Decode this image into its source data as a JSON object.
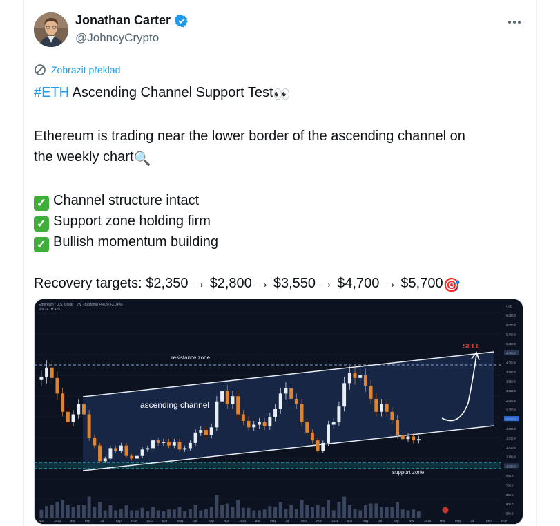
{
  "author": {
    "name": "Jonathan Carter",
    "handle": "@JohncyCrypto",
    "verified": true,
    "avatar_icon": "avatar-photo"
  },
  "more_icon": "more-dots-icon",
  "translate": {
    "label": "Zobrazit překlad",
    "icon": "translate-icon"
  },
  "tweet": {
    "hashtag": "#ETH",
    "title_rest": " Ascending Channel Support Test",
    "title_emoji": "👀",
    "line2": "Ethereum is trading near the lower border of the ascending channel on",
    "line3": "the weekly chart",
    "line3_emoji": "🔍",
    "checks": [
      "Channel structure intact",
      "Support zone holding firm",
      "Bullish momentum building"
    ],
    "targets": "Recovery targets: $2,350 → $2,800 → $3,550 → $4,700 → $5,700",
    "targets_emoji": "🎯"
  },
  "colors": {
    "link": "#1d9bf0",
    "text": "#0f1419",
    "muted": "#536471",
    "check": "#3fae3a",
    "chart_bg": "#0d1220",
    "candle_up": "#e8eef5",
    "candle_down": "#e0832f",
    "sell": "#e53935"
  },
  "chart": {
    "header": "Ethereum / U.S. Dollar · 1W · Bitstamp  +60.3 (+3.04%)",
    "subheader": "Vol · ETH  47K",
    "labels": {
      "resistance": "resistance zone",
      "channel": "ascending channel",
      "support": "support zone",
      "sell": "SELL"
    },
    "price_ticks": [
      "USD",
      "6,400.0",
      "6,000.0",
      "5,700.0",
      "5,250.0",
      "4,700.0",
      "4,250.0",
      "3,850.0",
      "3,550.0",
      "3,250.0",
      "2,800.0",
      "2,350.0",
      "2,042.4",
      "1,900.0",
      "1,550.0",
      "1,410.0",
      "1,190.0",
      "1,050.0",
      "905.0",
      "780.0",
      "685.0",
      "605.0",
      "535.0"
    ],
    "time_ticks": [
      "Nov",
      "2022",
      "Mar",
      "May",
      "Jul",
      "Sep",
      "Nov",
      "2023",
      "Mar",
      "May",
      "Jul",
      "Sep",
      "Nov",
      "2024",
      "Mar",
      "May",
      "Jul",
      "Sep",
      "Nov",
      "2025",
      "Mar",
      "May",
      "Jul",
      "Sep",
      "Nov",
      "2026",
      "Mar",
      "May",
      "Jul",
      "Sep",
      "Nov"
    ],
    "series": {
      "name": "ETH weekly close",
      "values": [
        4350,
        4700,
        4300,
        3700,
        3000,
        2600,
        2900,
        3300,
        2900,
        2000,
        1700,
        1100,
        1200,
        1600,
        1500,
        1700,
        1300,
        1200,
        1300,
        1550,
        1600,
        1900,
        1800,
        1850,
        1700,
        1850,
        1550,
        1600,
        1800,
        2200,
        2300,
        2100,
        2400,
        3400,
        3800,
        3300,
        3600,
        2900,
        2650,
        2400,
        2500,
        2600,
        2450,
        2800,
        3100,
        3700,
        3900,
        3500,
        3300,
        2600,
        2200,
        1900,
        1500,
        1800,
        2500,
        2600,
        3200,
        4100,
        4500,
        4300,
        4400,
        4000,
        3500,
        3000,
        3300,
        3000,
        2700,
        2100,
        1950,
        2050,
        1900,
        1950
      ]
    }
  }
}
